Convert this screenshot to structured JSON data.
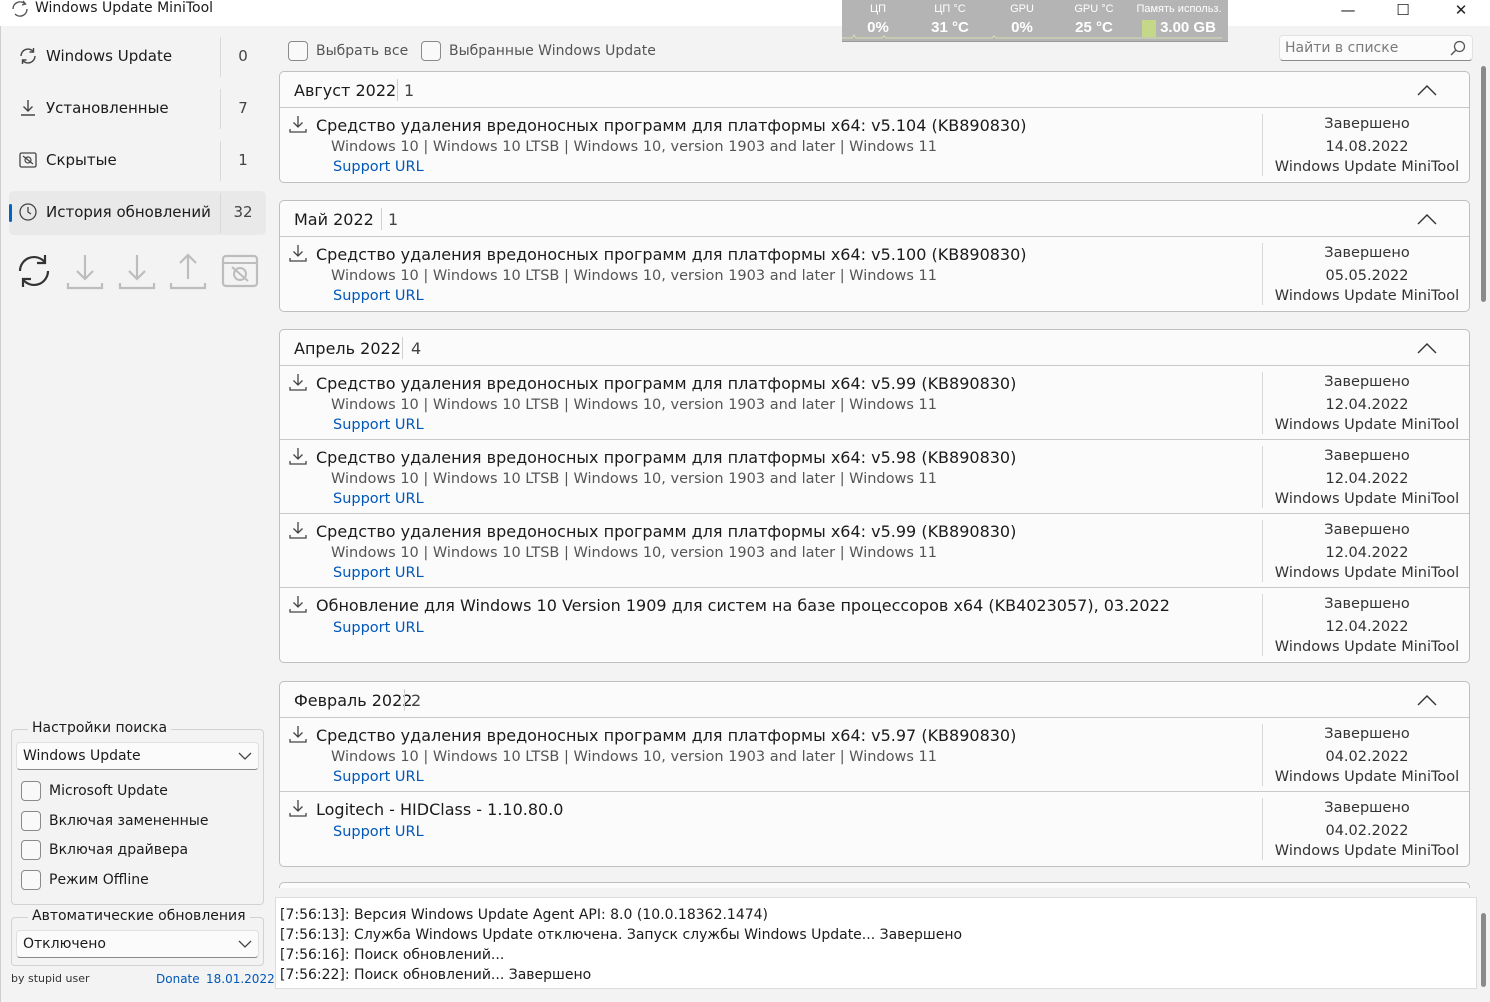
{
  "window": {
    "title": "Windows Update MiniTool",
    "minimize": "—",
    "maximize": "☐",
    "close": "✕"
  },
  "perf_monitor": {
    "cpu_label": "ЦП",
    "cpu_value": "0%",
    "cpu_temp_label": "ЦП °C",
    "cpu_temp_value": "31 °C",
    "gpu_label": "GPU",
    "gpu_value": "0%",
    "gpu_temp_label": "GPU °C",
    "gpu_temp_value": "25 °C",
    "mem_label": "Память использ.",
    "mem_value": "3.00 GB"
  },
  "sidebar": {
    "items": [
      {
        "label": "Windows Update",
        "count": "0",
        "icon": "refresh-icon"
      },
      {
        "label": "Установленные",
        "count": "7",
        "icon": "download-icon"
      },
      {
        "label": "Скрытые",
        "count": "1",
        "icon": "hidden-icon"
      },
      {
        "label": "История обновлений",
        "count": "32",
        "icon": "history-icon",
        "active": true
      }
    ],
    "toolbar": [
      "refresh-icon",
      "download-icon",
      "install-icon",
      "upload-icon",
      "hide-icon"
    ]
  },
  "search_settings": {
    "legend": "Настройки поиска",
    "source": "Windows Update",
    "options": [
      {
        "label": "Microsoft Update",
        "checked": false
      },
      {
        "label": "Включая замененные",
        "checked": false
      },
      {
        "label": "Включая драйвера",
        "checked": false
      },
      {
        "label": "Режим Offline",
        "checked": false
      }
    ]
  },
  "auto_updates": {
    "legend": "Автоматические обновления",
    "value": "Отключено"
  },
  "footer": {
    "user": "by stupid user",
    "donate": "Donate",
    "date": "18.01.2022"
  },
  "topbar": {
    "select_all": "Выбрать все",
    "selected_wu": "Выбранные Windows Update",
    "search_placeholder": "Найти в списке"
  },
  "groups": [
    {
      "month": "Август 2022",
      "count": "1",
      "updates": [
        {
          "title": "Средство удаления вредоносных программ для платформы x64: v5.104 (KB890830)",
          "products": "Windows 10 | Windows 10 LTSB | Windows 10, version 1903 and later | Windows 11",
          "url": "Support URL",
          "status": "Завершено",
          "date": "14.08.2022",
          "source": "Windows Update MiniTool"
        }
      ]
    },
    {
      "month": "Май 2022",
      "count": "1",
      "updates": [
        {
          "title": "Средство удаления вредоносных программ для платформы x64: v5.100 (KB890830)",
          "products": "Windows 10 | Windows 10 LTSB | Windows 10, version 1903 and later | Windows 11",
          "url": "Support URL",
          "status": "Завершено",
          "date": "05.05.2022",
          "source": "Windows Update MiniTool"
        }
      ]
    },
    {
      "month": "Апрель 2022",
      "count": "4",
      "updates": [
        {
          "title": "Средство удаления вредоносных программ для платформы x64: v5.99 (KB890830)",
          "products": "Windows 10 | Windows 10 LTSB | Windows 10, version 1903 and later | Windows 11",
          "url": "Support URL",
          "status": "Завершено",
          "date": "12.04.2022",
          "source": "Windows Update MiniTool"
        },
        {
          "title": "Средство удаления вредоносных программ для платформы x64: v5.98 (KB890830)",
          "products": "Windows 10 | Windows 10 LTSB | Windows 10, version 1903 and later | Windows 11",
          "url": "Support URL",
          "status": "Завершено",
          "date": "12.04.2022",
          "source": "Windows Update MiniTool"
        },
        {
          "title": "Средство удаления вредоносных программ для платформы x64: v5.99 (KB890830)",
          "products": "Windows 10 | Windows 10 LTSB | Windows 10, version 1903 and later | Windows 11",
          "url": "Support URL",
          "status": "Завершено",
          "date": "12.04.2022",
          "source": "Windows Update MiniTool"
        },
        {
          "title": "Обновление для Windows 10 Version 1909 для систем на базе процессоров x64 (KB4023057), 03.2022",
          "products": "",
          "url": "Support URL",
          "status": "Завершено",
          "date": "12.04.2022",
          "source": "Windows Update MiniTool"
        }
      ]
    },
    {
      "month": "Февраль 2022",
      "count": "2",
      "updates": [
        {
          "title": "Средство удаления вредоносных программ для платформы x64: v5.97 (KB890830)",
          "products": "Windows 10 | Windows 10 LTSB | Windows 10, version 1903 and later | Windows 11",
          "url": "Support URL",
          "status": "Завершено",
          "date": "04.02.2022",
          "source": "Windows Update MiniTool"
        },
        {
          "title": "Logitech - HIDClass - 1.10.80.0",
          "products": "",
          "url": "Support URL",
          "status": "Завершено",
          "date": "04.02.2022",
          "source": "Windows Update MiniTool"
        }
      ]
    }
  ],
  "log": [
    "[7:56:13]: Версия Windows Update Agent API: 8.0 (10.0.18362.1474)",
    "[7:56:13]: Служба Windows Update отключена. Запуск службы Windows Update... Завершено",
    "[7:56:16]: Поиск обновлений...",
    "[7:56:22]: Поиск обновлений... Завершено"
  ],
  "colors": {
    "accent": "#0067c0",
    "link": "#0057b8",
    "perf_bg": "#b4b4b4",
    "mem_bar": "#c5d88a"
  }
}
